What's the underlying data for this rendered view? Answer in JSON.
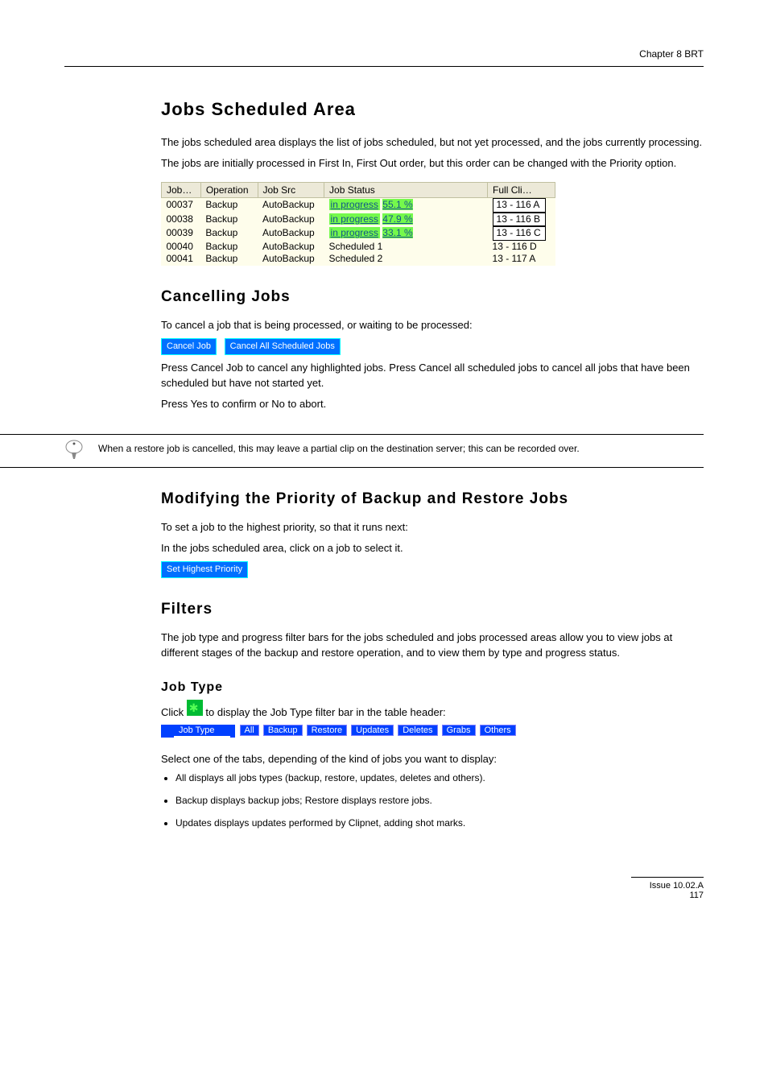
{
  "header": {
    "chapter": "Chapter 8 BRT"
  },
  "sections": {
    "jobs_scheduled_title": "Jobs  Scheduled  Area",
    "jobs_scheduled_desc1": "The jobs scheduled area displays the list of jobs scheduled, but not yet processed, and the jobs currently processing.",
    "jobs_scheduled_desc2": "The jobs are initially processed in First In, First Out order, but this order can be changed with the Priority option.",
    "cancelling_title": "Cancelling  Jobs",
    "cancelling_desc": "To cancel a job that is being processed, or waiting to be processed:",
    "cancelling_step1": "Press Cancel Job to cancel any highlighted jobs.  Press Cancel all scheduled jobs to cancel all jobs that have been scheduled but have not started yet.",
    "cancelling_step2": "Press Yes to confirm or No to abort.",
    "note_text": "When a restore job is cancelled, this may leave a partial clip on the destination server; this can be recorded over.",
    "priority_title": "Modifying  the  Priority  of  Backup  and  Restore  Jobs",
    "priority_desc": "To set a job to the highest priority, so that it runs next:",
    "priority_step1": "In the jobs scheduled area, click on a job to select it.",
    "priority_step2": "Set Highest Priority",
    "filters_title": "Filters",
    "filters_desc": "The job type and progress filter bars for the jobs scheduled and jobs processed areas allow you to view jobs at different stages of the backup and restore operation, and to view them by type and progress status.",
    "jobtype_title": "Job  Type",
    "jobtype_lead": "Click",
    "jobtype_table_note": "to display the Job Type filter bar in the table header:",
    "bullets": {
      "all": "All displays all jobs types (backup, restore, updates, deletes and others).",
      "backup_restore": "Backup displays backup jobs; Restore displays restore jobs.",
      "updates": "Updates displays updates performed by Clipnet, adding shot marks."
    }
  },
  "jobs_table": {
    "headers": {
      "job": "Job…",
      "operation": "Operation",
      "src": "Job Src",
      "status": "Job Status",
      "cli": "Full Cli…"
    },
    "rows": [
      {
        "id": "00037",
        "op": "Backup",
        "src": "AutoBackup",
        "status_prefix": "in progress",
        "pct": "55.1 %",
        "cli": "13 - 116 A"
      },
      {
        "id": "00038",
        "op": "Backup",
        "src": "AutoBackup",
        "status_prefix": "in progress",
        "pct": "47.9 %",
        "cli": "13 - 116 B"
      },
      {
        "id": "00039",
        "op": "Backup",
        "src": "AutoBackup",
        "status_prefix": "in progress",
        "pct": "33.1 %",
        "cli": "13 - 116 C"
      },
      {
        "id": "00040",
        "op": "Backup",
        "src": "AutoBackup",
        "status_plain": "Scheduled 1",
        "cli": "13 - 116 D"
      },
      {
        "id": "00041",
        "op": "Backup",
        "src": "AutoBackup",
        "status_plain": "Scheduled 2",
        "cli": "13 - 117 A"
      }
    ]
  },
  "buttons": {
    "cancel_job": "Cancel Job",
    "cancel_all": "Cancel All Scheduled Jobs",
    "set_priority": "Set Highest Priority"
  },
  "filter_bar": {
    "label": "Job Type",
    "tabs": [
      "All",
      "Backup",
      "Restore",
      "Updates",
      "Deletes",
      "Grabs",
      "Others"
    ]
  },
  "footer": {
    "issue": "Issue 10.02.A",
    "page": "117"
  }
}
